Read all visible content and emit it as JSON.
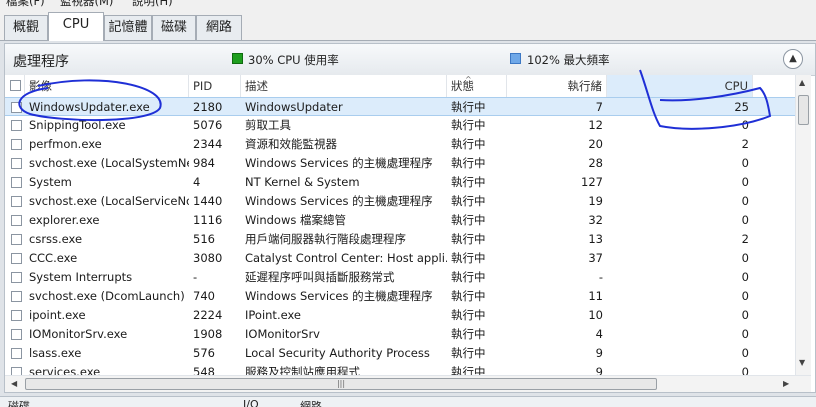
{
  "menu": {
    "items": [
      "檔案(F)",
      "監視器(M)",
      "說明(H)"
    ]
  },
  "tabs": [
    "概觀",
    "CPU",
    "記憶體",
    "磁碟",
    "網路"
  ],
  "active_tab": "CPU",
  "panel": {
    "title": "處理程序",
    "cpu_usage": "30% CPU 使用率",
    "max_freq": "102% 最大頻率",
    "usage_color": "#1e9e1e",
    "freq_color": "#6fa8e8"
  },
  "columns": {
    "image": "影像",
    "pid": "PID",
    "desc": "描述",
    "status": "狀態",
    "threads": "執行緒",
    "cpu": "CPU"
  },
  "rows": [
    {
      "image": "WindowsUpdater.exe",
      "pid": "2180",
      "desc": "WindowsUpdater",
      "status": "執行中",
      "threads": "7",
      "cpu": "25"
    },
    {
      "image": "SnippingTool.exe",
      "pid": "5076",
      "desc": "剪取工具",
      "status": "執行中",
      "threads": "12",
      "cpu": "0"
    },
    {
      "image": "perfmon.exe",
      "pid": "2344",
      "desc": "資源和效能監視器",
      "status": "執行中",
      "threads": "20",
      "cpu": "2"
    },
    {
      "image": "svchost.exe (LocalSystemNe...",
      "pid": "984",
      "desc": "Windows Services 的主機處理程序",
      "status": "執行中",
      "threads": "28",
      "cpu": "0"
    },
    {
      "image": "System",
      "pid": "4",
      "desc": "NT Kernel & System",
      "status": "執行中",
      "threads": "127",
      "cpu": "0"
    },
    {
      "image": "svchost.exe (LocalServiceNo...",
      "pid": "1440",
      "desc": "Windows Services 的主機處理程序",
      "status": "執行中",
      "threads": "19",
      "cpu": "0"
    },
    {
      "image": "explorer.exe",
      "pid": "1116",
      "desc": "Windows 檔案總管",
      "status": "執行中",
      "threads": "32",
      "cpu": "0"
    },
    {
      "image": "csrss.exe",
      "pid": "516",
      "desc": "用戶端伺服器執行階段處理程序",
      "status": "執行中",
      "threads": "13",
      "cpu": "2"
    },
    {
      "image": "CCC.exe",
      "pid": "3080",
      "desc": "Catalyst Control Center: Host appli...",
      "status": "執行中",
      "threads": "37",
      "cpu": "0"
    },
    {
      "image": "System Interrupts",
      "pid": "-",
      "desc": "延遲程序呼叫與插斷服務常式",
      "status": "執行中",
      "threads": "-",
      "cpu": "0"
    },
    {
      "image": "svchost.exe (DcomLaunch)",
      "pid": "740",
      "desc": "Windows Services 的主機處理程序",
      "status": "執行中",
      "threads": "11",
      "cpu": "0"
    },
    {
      "image": "ipoint.exe",
      "pid": "2224",
      "desc": "IPoint.exe",
      "status": "執行中",
      "threads": "10",
      "cpu": "0"
    },
    {
      "image": "IOMonitorSrv.exe",
      "pid": "1908",
      "desc": "IOMonitorSrv",
      "status": "執行中",
      "threads": "4",
      "cpu": "0"
    },
    {
      "image": "lsass.exe",
      "pid": "576",
      "desc": "Local Security Authority Process",
      "status": "執行中",
      "threads": "9",
      "cpu": "0"
    },
    {
      "image": "services.exe",
      "pid": "548",
      "desc": "服務及控制站應用程式",
      "status": "執行中",
      "threads": "9",
      "cpu": "0"
    }
  ],
  "scroll": {
    "h_grip": "|||"
  },
  "footer": {
    "left": "磁碟",
    "mid": "I/O",
    "right": "網路"
  }
}
